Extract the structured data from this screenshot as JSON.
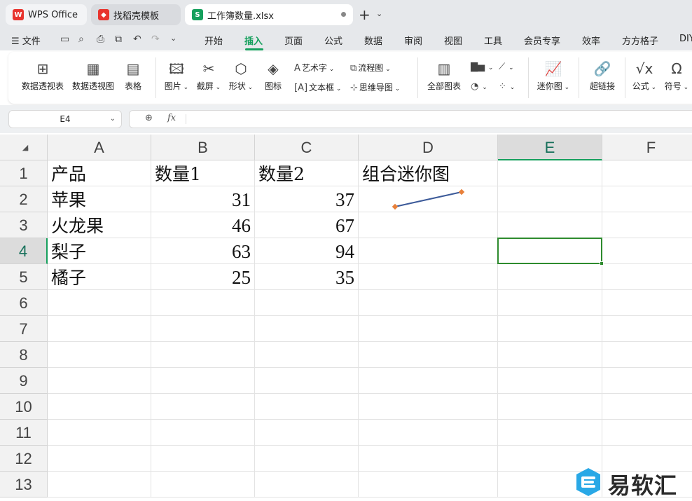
{
  "tabs": {
    "wps": {
      "label": "WPS Office",
      "icon": "wps-logo-icon"
    },
    "template": {
      "label": "找稻壳模板",
      "icon": "daoke-logo-icon"
    },
    "file": {
      "label": "工作簿数量.xlsx",
      "icon_text": "S"
    },
    "add_symbol": "+",
    "more_symbol": "⌄"
  },
  "menu": {
    "file_label": "文件",
    "items": [
      "开始",
      "插入",
      "页面",
      "公式",
      "数据",
      "审阅",
      "视图",
      "工具",
      "会员专享",
      "效率",
      "方方格子",
      "DIY"
    ],
    "active": "插入"
  },
  "ribbon": {
    "pivot_table": "数据透视表",
    "pivot_chart": "数据透视图",
    "table": "表格",
    "picture": "图片",
    "screenshot": "截屏",
    "shape": "形状",
    "icons": "图标",
    "art_text": "艺术字",
    "text_box": "文本框",
    "flowchart": "流程图",
    "mindmap": "思维导图",
    "all_charts": "全部图表",
    "sparkline": "迷你图",
    "hyperlink": "超链接",
    "formula": "公式",
    "symbol": "符号"
  },
  "formula_bar": {
    "name_box": "E4",
    "fx_label": "fx",
    "content": ""
  },
  "columns": [
    "A",
    "B",
    "C",
    "D",
    "E",
    "F"
  ],
  "selected_column": "E",
  "rows": [
    "1",
    "2",
    "3",
    "4",
    "5",
    "6",
    "7",
    "8",
    "9",
    "10",
    "11",
    "12",
    "13"
  ],
  "selected_row": "4",
  "cells": {
    "A1": "产品",
    "B1": "数量1",
    "C1": "数量2",
    "D1": "组合迷你图",
    "A2": "苹果",
    "B2": "31",
    "C2": "37",
    "A3": "火龙果",
    "B3": "46",
    "C3": "67",
    "A4": "梨子",
    "B4": "63",
    "C4": "94",
    "A5": "橘子",
    "B5": "25",
    "C5": "35"
  },
  "sparkline": {
    "cell": "D2",
    "values": [
      31,
      37
    ],
    "line_color": "#3c5a99",
    "marker_color": "#e8803a"
  },
  "watermark": {
    "text": "易软汇",
    "icon_color": "#29a8e6"
  },
  "colors": {
    "accent": "#16a05d",
    "selection": "#2e8b2e"
  }
}
